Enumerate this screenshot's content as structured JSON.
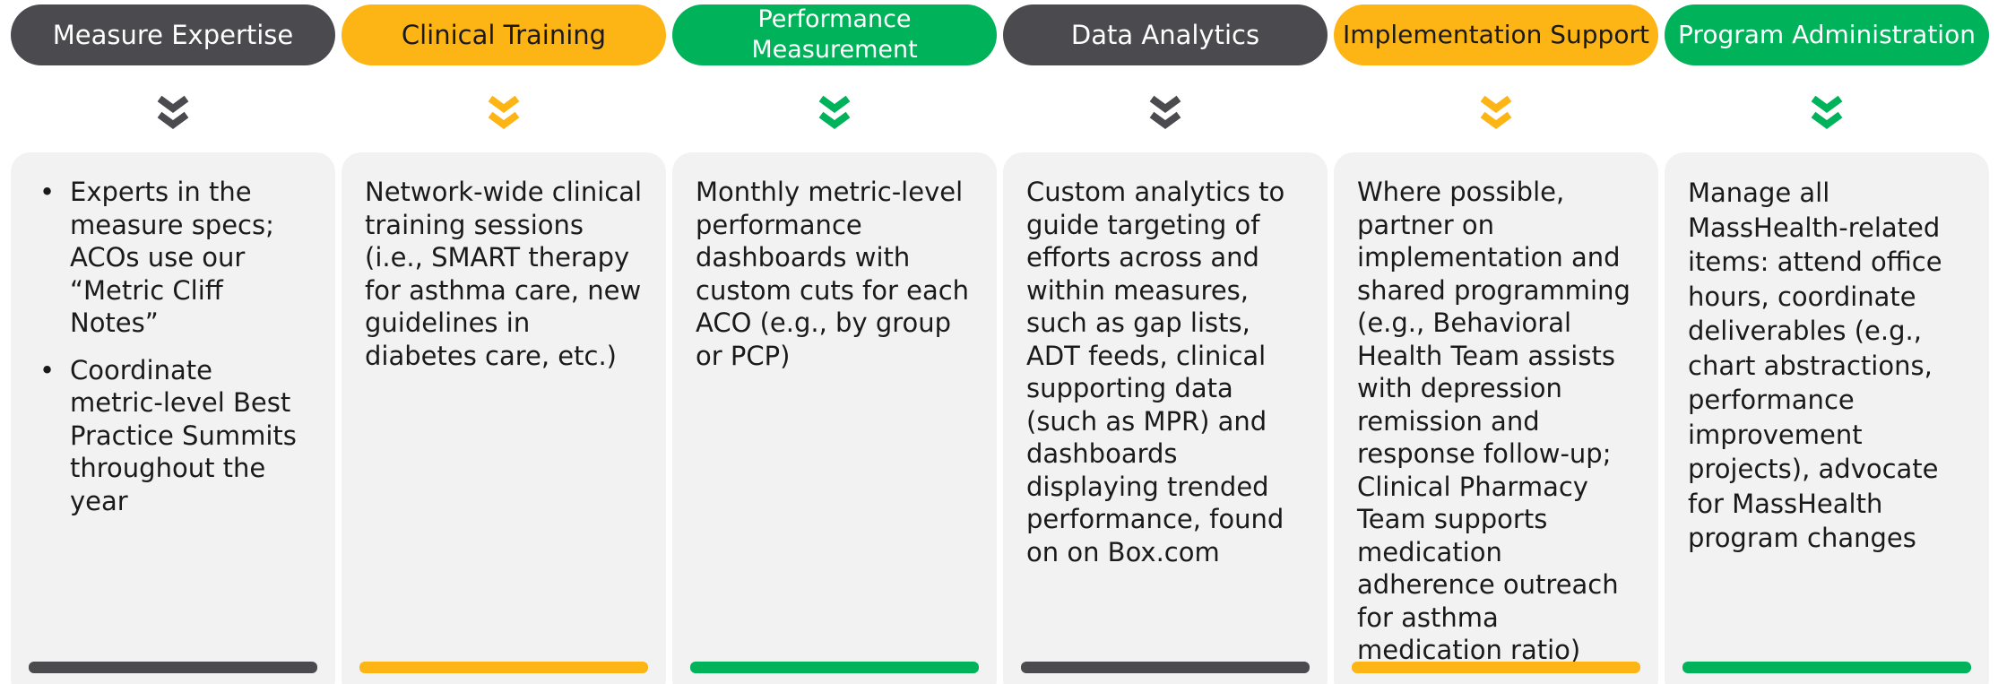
{
  "colors": {
    "dark": "#4a4a4f",
    "yellow": "#fdb415",
    "green": "#00b25a"
  },
  "columns": [
    {
      "title": "Measure Expertise",
      "color": "dark",
      "text_color": "#ffffff",
      "icon": "double-chevron-down-icon",
      "bullets": [
        "Experts in the measure specs; ACOs use our “Metric Cliff Notes”",
        "Coordinate metric-level Best Practice Summits throughout the year"
      ]
    },
    {
      "title": "Clinical Training",
      "color": "yellow",
      "text_color": "#1a1a1a",
      "icon": "double-chevron-down-icon",
      "body": "Network-wide clinical training sessions (i.e., SMART therapy for asthma care, new guidelines in diabetes care, etc.)"
    },
    {
      "title": "Performance\nMeasurement",
      "color": "green",
      "text_color": "#ffffff",
      "icon": "double-chevron-down-icon",
      "body": "Monthly metric-level performance dashboards with custom cuts for each ACO (e.g., by group or PCP)"
    },
    {
      "title": "Data Analytics",
      "color": "dark",
      "text_color": "#ffffff",
      "icon": "double-chevron-down-icon",
      "body": "Custom analytics to guide targeting of efforts across and within measures, such as gap lists, ADT feeds, clinical supporting data (such as MPR) and dashboards displaying trended performance, found on on Box.com"
    },
    {
      "title": "Implementation Support",
      "color": "yellow",
      "text_color": "#1a1a1a",
      "icon": "double-chevron-down-icon",
      "body": "Where possible, partner on implementation and shared programming (e.g., Behavioral Health Team assists with depression remission and response follow-up; Clinical Pharmacy Team supports medication adherence outreach for asthma medication ratio)"
    },
    {
      "title": "Program Administration",
      "color": "green",
      "text_color": "#ffffff",
      "icon": "double-chevron-down-icon",
      "body": "Manage all MassHealth-related items: attend office hours, coordinate deliverables (e.g., chart abstractions, performance improvement projects), advocate for MassHealth program changes"
    }
  ]
}
